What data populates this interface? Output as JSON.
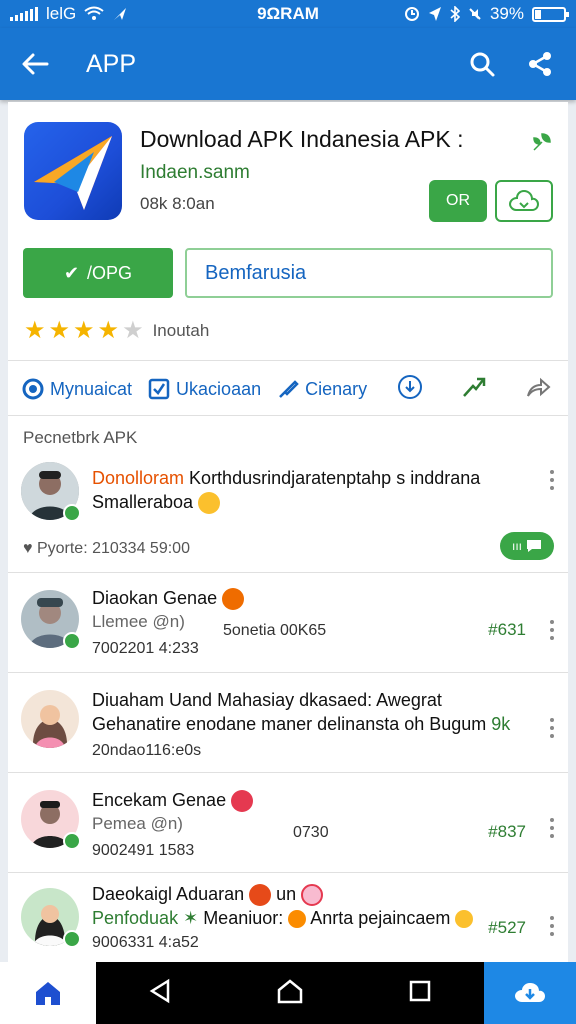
{
  "status": {
    "carrier": "lelG",
    "time": "9ΩRAM",
    "battery": "39%"
  },
  "appbar": {
    "title": "APP",
    "back_icon": "arrow-left-icon",
    "search_icon": "search-icon",
    "share_icon": "share-icon"
  },
  "app": {
    "title": "Download APK Indanesia  APK :",
    "developer": "Indaen.sanm",
    "meta": "08k 8:0an",
    "or_label": "OR",
    "open_label": "/OPG",
    "field_label": "Bemfarusia",
    "rating": 4,
    "rating_label": "Inoutah"
  },
  "actions": [
    {
      "icon": "circle-icon",
      "label": "Mynuaicat"
    },
    {
      "icon": "square-check-icon",
      "label": "Ukacioaan"
    },
    {
      "icon": "tag-icon",
      "label": "Cienary"
    }
  ],
  "section_title": "Pecnetbrk APK",
  "posts": [
    {
      "name": "Donolloram",
      "text1": " Korthdusrindjaratenptahp s inddrana",
      "text2": "Smalleraboa",
      "meta": "Pyorte: 210334 59:00"
    },
    {
      "name": "Diaokan Genae",
      "line2": "Llemee @n)",
      "date": "7002201 4:233",
      "middle": "5onetia 00K65",
      "count": "#631"
    },
    {
      "name": "Diuaham Uand Mahasiay dkasaed: Awegrat",
      "line2": "Gehanatire enodane maner delinansta oh Bugum",
      "line2_tail": "9k",
      "date": "20ndao116:e0s"
    },
    {
      "name": "Encekam Genae",
      "line2": "Pemea @n)",
      "date": "9002491 1583",
      "middle": "0730",
      "count": "#837"
    },
    {
      "name": "Daeokaigl Aduaran",
      "name_tail": "un",
      "line2_green": "Penfoduak",
      "line2": " Meaniuor: ",
      "line2_b": "Anrta pejaincaem",
      "date": "9006331 4:a52",
      "count": "#527"
    }
  ],
  "colors": {
    "primary": "#1976d2",
    "green": "#3aa647",
    "star": "#f5b400"
  }
}
